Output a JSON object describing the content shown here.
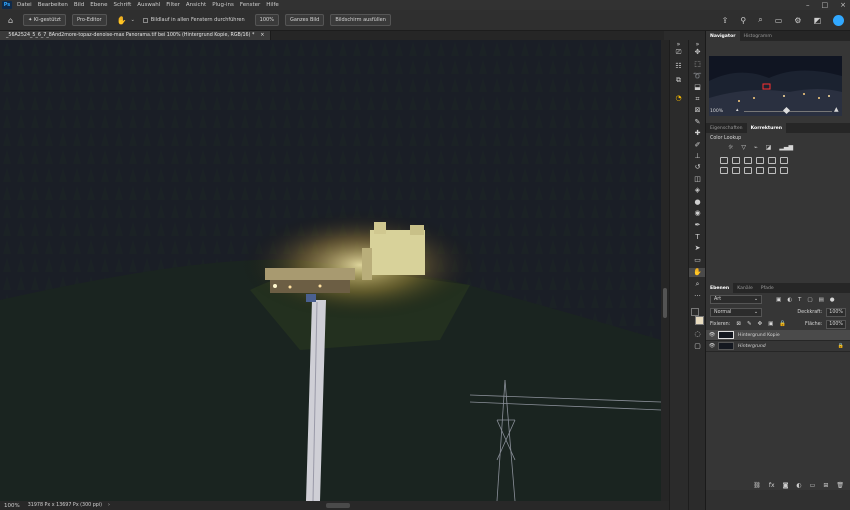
{
  "app": {
    "logo": "Ps"
  },
  "menu": [
    "Datei",
    "Bearbeiten",
    "Bild",
    "Ebene",
    "Schrift",
    "Auswahl",
    "Filter",
    "Ansicht",
    "Plug-ins",
    "Fenster",
    "Hilfe"
  ],
  "options": {
    "ai_label": "KI-gestützt",
    "pro_editor": "Pro-Editor",
    "scroll_all": "Bildlauf in allen Fenstern durchführen",
    "zoom_100": "100%",
    "fit_screen": "Ganzes Bild",
    "fill_screen": "Bildschirm ausfüllen"
  },
  "document": {
    "tab_title": "_56A2524_5_6_7_8And2more-topaz-denoise-max Panorama.tif bei 100% (Hintergrund Kopie, RGB/16) *",
    "tab_close": "×"
  },
  "status": {
    "zoom": "100%",
    "info": "31978 Px x 13697 Px (300 ppi)"
  },
  "navigator": {
    "tab_active": "Navigator",
    "tab_other": "Histogramm",
    "zoom": "100%"
  },
  "adjustments": {
    "tab_props": "Eigenschaften",
    "tab_active": "Korrekturen",
    "label": "Color Lookup"
  },
  "layers": {
    "tabs": [
      "Ebenen",
      "Kanäle",
      "Pfade"
    ],
    "filter_kind": "Art",
    "blend_mode": "Normal",
    "opacity_label": "Deckkraft:",
    "opacity_value": "100%",
    "lock_label": "Fixieren:",
    "fill_label": "Fläche:",
    "fill_value": "100%",
    "items": [
      {
        "name": "Hintergrund Kopie",
        "selected": true
      },
      {
        "name": "Hintergrund",
        "selected": false
      }
    ]
  },
  "colors": {
    "foreground": "#1a1a1a",
    "background": "#ffffff",
    "accent": "#31a8ff"
  }
}
